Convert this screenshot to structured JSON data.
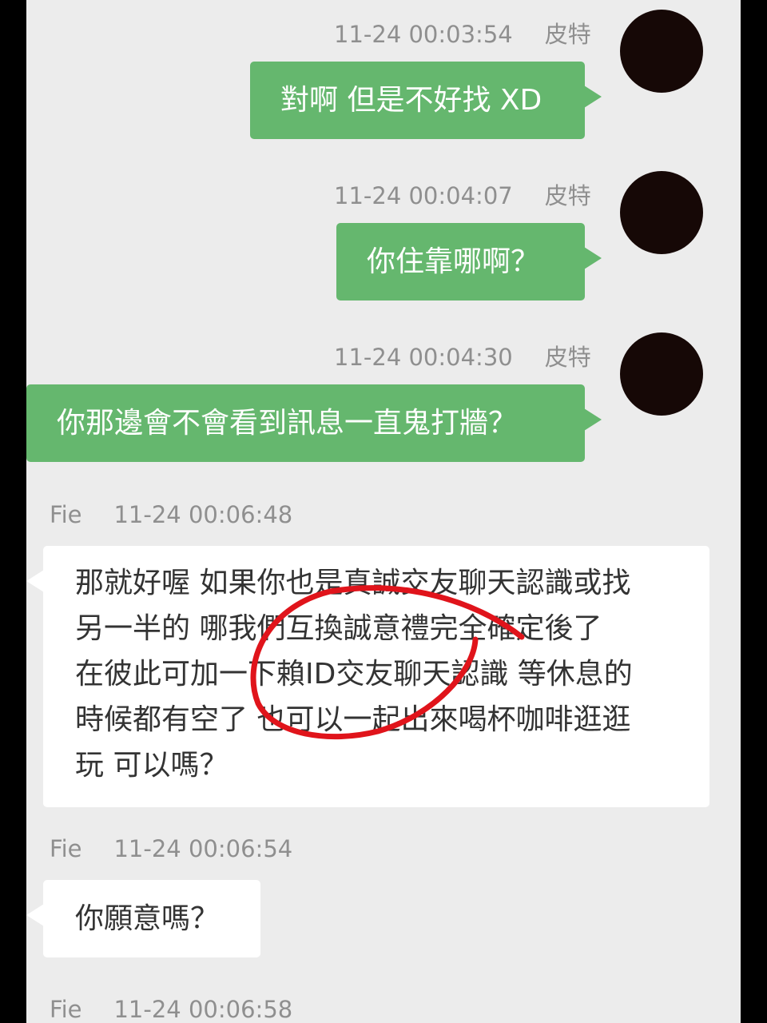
{
  "messages": [
    {
      "time": "11-24 00:03:54",
      "name": "皮特",
      "text": "對啊 但是不好找 XD"
    },
    {
      "time": "11-24 00:04:07",
      "name": "皮特",
      "text": "你住靠哪啊？"
    },
    {
      "time": "11-24 00:04:30",
      "name": "皮特",
      "text": "你那邊會不會看到訊息一直鬼打牆？"
    },
    {
      "time": "11-24 00:06:48",
      "name": "Fie",
      "lines": [
        "那就好喔 如果你也是真誠交友聊天認識或找",
        "另一半的 哪我們互換誠意禮完全確定後了",
        "在彼此可加一下賴ID交友聊天認識 等休息的",
        "時候都有空了 也可以一起出來喝杯咖啡逛逛",
        "玩 可以嗎？"
      ]
    },
    {
      "time": "11-24 00:06:54",
      "name": "Fie",
      "text": "你願意嗎？"
    },
    {
      "time": "11-24 00:06:58",
      "name": "Fie"
    }
  ],
  "colors": {
    "outgoing_bubble": "#65b76e",
    "incoming_bubble": "#ffffff",
    "background": "#ececec",
    "annotation": "#e0141b"
  },
  "icons": {
    "avatar": "avatar-icon"
  }
}
